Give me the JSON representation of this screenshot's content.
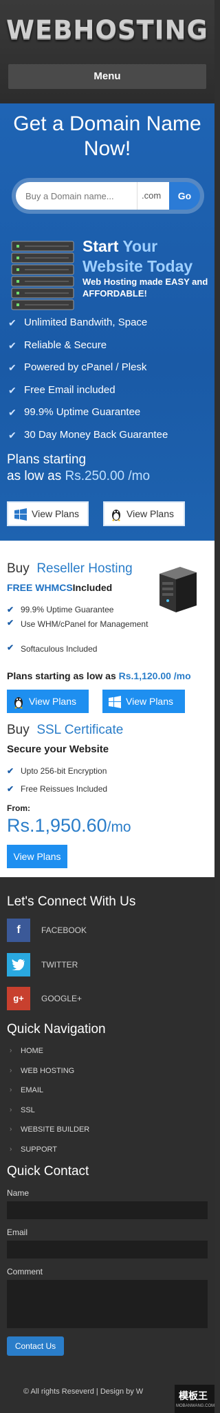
{
  "header": {
    "logo": "WEBHOSTING",
    "menu_label": "Menu"
  },
  "domain": {
    "heading": "Get a Domain Name Now!",
    "search_placeholder": "Buy a Domain name...",
    "tld": ".com",
    "go_label": "Go",
    "start_word": "Start",
    "your_word": "Your",
    "website_today": "Website Today",
    "subline": "Web Hosting made EASY and AFFORDABLE!",
    "features": [
      "Unlimited Bandwith, Space",
      "Reliable & Secure",
      "Powered by cPanel / Plesk",
      "Free Email included",
      "99.9% Uptime Guarantee",
      "30 Day Money Back Guarantee"
    ],
    "plans_line1": "Plans starting",
    "plans_line2_prefix": "as low as",
    "plans_price": "Rs.250.00 /mo",
    "view_plans_windows": "View Plans",
    "view_plans_linux": "View Plans"
  },
  "reseller": {
    "buy": "Buy",
    "product": "Reseller Hosting",
    "free_whmcs": "FREE WHMCS",
    "included": "Included",
    "features": [
      "99.9% Uptime Guarantee",
      "Use WHM/cPanel for Management",
      "Softaculous Included"
    ],
    "plans_prefix": "Plans starting as low as",
    "plans_price": "Rs.1,120.00 /mo",
    "view_plans_1": "View Plans",
    "view_plans_2": "View Plans"
  },
  "ssl": {
    "buy": "Buy",
    "product": "SSL Certificate",
    "subtitle": "Secure your Website",
    "features": [
      "Upto 256-bit Encryption",
      "Free Reissues Included"
    ],
    "from_label": "From:",
    "price": "Rs.1,950.60",
    "price_unit": "/mo",
    "view_plans": "View Plans"
  },
  "footer": {
    "connect_title": "Let's Connect With Us",
    "social": [
      {
        "label": "FACEBOOK",
        "icon": "facebook-icon",
        "color": "#3b5998"
      },
      {
        "label": "TWITTER",
        "icon": "twitter-icon",
        "color": "#2aa9e0"
      },
      {
        "label": "GOOGLE+",
        "icon": "google-plus-icon",
        "color": "#c8402e"
      }
    ],
    "nav_title": "Quick Navigation",
    "nav_items": [
      "HOME",
      "WEB HOSTING",
      "EMAIL",
      "SSL",
      "WEBSITE BUILDER",
      "SUPPORT"
    ],
    "contact_title": "Quick Contact",
    "name_label": "Name",
    "email_label": "Email",
    "comment_label": "Comment",
    "contact_button": "Contact Us",
    "copyright": "© All rights Reseverd | Design by W",
    "watermark_cn": "模板王",
    "watermark_url": "MOBANWANG.COM"
  },
  "colors": {
    "accent_blue": "#1e8ff0",
    "header_blue": "#1f64b4",
    "link_blue": "#2a7dc9"
  }
}
